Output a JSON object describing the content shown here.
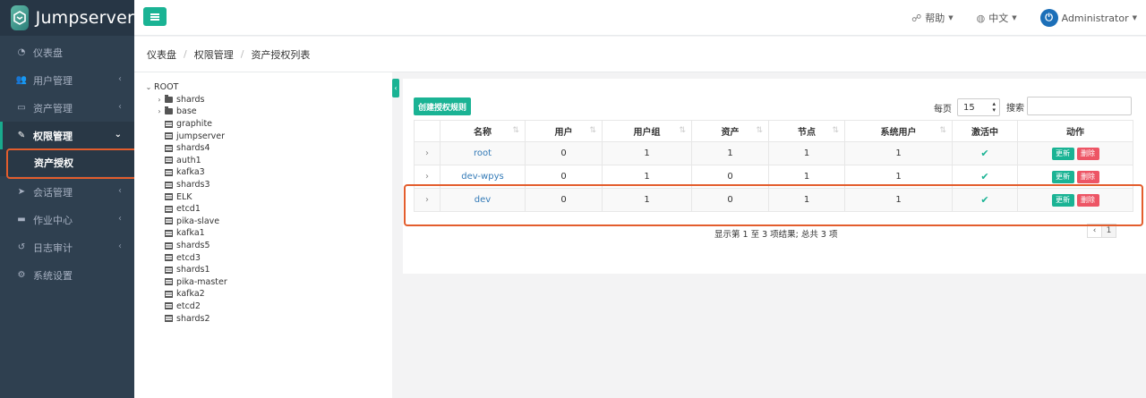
{
  "app": {
    "name": "Jumpserver"
  },
  "sidebar": {
    "items": [
      {
        "label": "仪表盘",
        "icon": "dashboard-icon",
        "has_children": false
      },
      {
        "label": "用户管理",
        "icon": "users-icon",
        "has_children": true
      },
      {
        "label": "资产管理",
        "icon": "monitor-icon",
        "has_children": true
      },
      {
        "label": "权限管理",
        "icon": "edit-icon",
        "has_children": true,
        "active": true
      },
      {
        "label": "会话管理",
        "icon": "rocket-icon",
        "has_children": true
      },
      {
        "label": "作业中心",
        "icon": "terminal-icon",
        "has_children": true
      },
      {
        "label": "日志审计",
        "icon": "history-icon",
        "has_children": true
      },
      {
        "label": "系统设置",
        "icon": "gears-icon",
        "has_children": false
      }
    ],
    "sub_item": "资产授权"
  },
  "topbar": {
    "help": "帮助",
    "language": "中文",
    "user": "Administrator"
  },
  "breadcrumb": [
    "仪表盘",
    "权限管理",
    "资产授权列表"
  ],
  "tree": {
    "root": "ROOT",
    "folders": [
      "shards",
      "base"
    ],
    "leaves": [
      "graphite",
      "jumpserver",
      "shards4",
      "auth1",
      "kafka3",
      "shards3",
      "ELK",
      "etcd1",
      "pika-slave",
      "kafka1",
      "shards5",
      "etcd3",
      "shards1",
      "pika-master",
      "kafka2",
      "etcd2",
      "shards2"
    ]
  },
  "toolbar": {
    "create_label": "创建授权规则",
    "per_page_label": "每页",
    "per_page_value": "15",
    "search_label": "搜索"
  },
  "table": {
    "headers": [
      "名称",
      "用户",
      "用户组",
      "资产",
      "节点",
      "系统用户",
      "激活中",
      "动作"
    ],
    "rows": [
      {
        "name": "root",
        "users": "0",
        "groups": "1",
        "assets": "1",
        "nodes": "1",
        "system_users": "1"
      },
      {
        "name": "dev-wpys",
        "users": "0",
        "groups": "1",
        "assets": "0",
        "nodes": "1",
        "system_users": "1"
      },
      {
        "name": "dev",
        "users": "0",
        "groups": "1",
        "assets": "0",
        "nodes": "1",
        "system_users": "1"
      }
    ],
    "update_label": "更新",
    "delete_label": "删除"
  },
  "summary": "显示第 1 至 3 项结果; 总共 3 项",
  "pager": {
    "prev": "‹",
    "current": "1"
  },
  "colors": {
    "accent": "#1ab394",
    "danger": "#ed5565",
    "sidebar": "#2f4050",
    "highlight": "#e35d2d"
  }
}
